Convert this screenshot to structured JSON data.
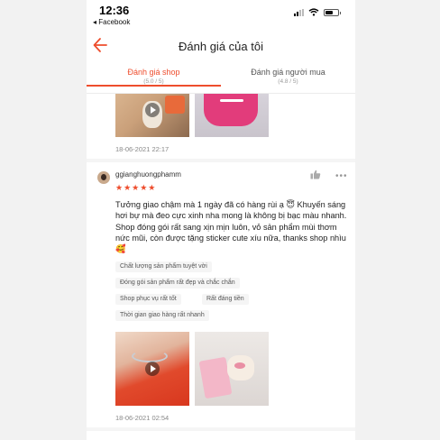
{
  "status_bar": {
    "time": "12:36",
    "back_app": "◂ Facebook"
  },
  "nav": {
    "title": "Đánh giá của tôi"
  },
  "tabs": [
    {
      "label": "Đánh giá shop",
      "score": "(5.0 / 5)"
    },
    {
      "label": "Đánh giá người mua",
      "score": "(4.8 / 5)"
    }
  ],
  "review_top": {
    "date": "18-06-2021 22:17"
  },
  "review": {
    "username": "ggianghuongphamm",
    "stars": "★★★★★",
    "rating": 5,
    "text": "Tưởng giao chậm mà 1 ngày đã có hàng rùi ạ 😇 Khuyến sáng hơi bự mà đeo cực xinh nha mong là không bị bạc màu nhanh. Shop đóng gói rất sang xịn mịn luôn, vỏ sản phẩm mùi thơm nức mũi, còn được tặng sticker cute xíu nữa, thanks shop nhìu 🥰",
    "tags": [
      "Chất lượng sản phẩm tuyệt vời",
      "Đóng gói sản phẩm rất đẹp và chắc chắn",
      "Shop phục vụ rất tốt",
      "Rất đáng tiền",
      "Thời gian giao hàng rất nhanh"
    ],
    "date": "18-06-2021 02:54"
  },
  "icons": {
    "back": "arrow-left-icon",
    "like": "thumbs-up-icon",
    "more": "more-dots-icon",
    "play": "play-icon"
  },
  "colors": {
    "accent": "#ee4d2d"
  }
}
